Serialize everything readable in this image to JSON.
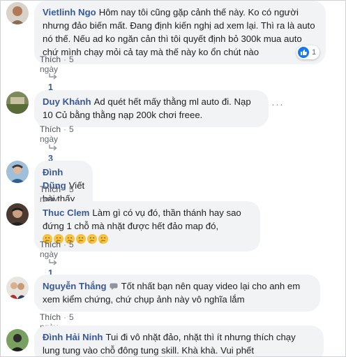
{
  "colors": {
    "author": "#385898",
    "bubble": "#f2f3f5",
    "meta": "#616770",
    "like_blue": "#1877f2"
  },
  "comments": [
    {
      "author": "Vietlinh Ngo",
      "text": "Hôm nay tôi cũng gặp cảnh thế này. Ko có người nhưng đảo biến mất. Đang định kiến nghị ad xem lại. Thì ra là auto nó thế. Nếu ad ko ngăn cản thì tôi quyết định bỏ 300k mua auto chứ mình chạy mỏi cả tay mà thế này ko ổn chút nào",
      "like_label": "Thích",
      "time": "5 ngày",
      "replies": "1 phản hồi",
      "reaction_count": "1"
    },
    {
      "author": "Duy Khánh",
      "text": "Ad quét hết mấy thằng ml auto đi. Nạp 10 Củ bằng thằng nạp 200k chơi freee.",
      "like_label": "Thích",
      "time": "5 ngày",
      "replies": "3 phản hồi",
      "more_icon": "more-options-icon"
    },
    {
      "author": "Đình Dũng",
      "text": "Viết bài thấy buồn cười vcl :))",
      "like_label": "Thích",
      "time": "5 ngày"
    },
    {
      "author": "Thuc Clem",
      "text": "Làm gì có vụ đó, thần thánh hay sao đứng 1 chỗ mà nhặt được hết đảo map đó,",
      "like_label": "Thích",
      "time": "5 ngày",
      "replies": "1 phản hồi",
      "emojis": [
        "thinking-face-icon",
        "thinking-face-icon",
        "thinking-face-icon",
        "thinking-face-icon",
        "thinking-face-icon",
        "thinking-face-icon"
      ]
    },
    {
      "author": "Nguyễn Thắng",
      "text": "Tốt nhất bạn nên quay video lại cho anh em xem kiểm chứng, chứ chụp ảnh này vô nghĩa lắm",
      "like_label": "Thích",
      "time": "5 ngày"
    },
    {
      "author": "Đình Hải Ninh",
      "text": "Tui đi vô nhặt đảo, nhặt thì ít nhưng thích chạy lung tung vào chỗ đông tung skill. Khà khà. Vui phết"
    }
  ]
}
